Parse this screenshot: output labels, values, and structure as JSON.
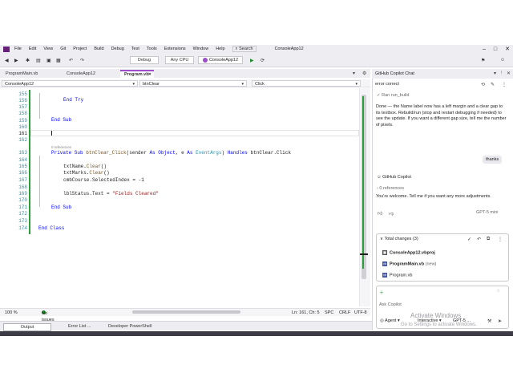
{
  "menu": {
    "items": [
      "File",
      "Edit",
      "View",
      "Git",
      "Project",
      "Build",
      "Debug",
      "Test",
      "Tools",
      "Extensions",
      "Window",
      "Help"
    ],
    "search": "Search",
    "solution_title": "ConsoleApp12"
  },
  "toolbar": {
    "config": "Debug",
    "platform": "Any CPU",
    "run_target": "ConsoleApp12"
  },
  "tabs": [
    {
      "label": "ProgramMain.vb",
      "active": false
    },
    {
      "label": "ConsoleApp12",
      "active": false
    },
    {
      "label": "Program.vb",
      "active": true
    }
  ],
  "nav": {
    "project": "ConsoleApp12",
    "member": "btnClear",
    "event": "Click"
  },
  "editor": {
    "lines": [
      {
        "n": "155",
        "text": ""
      },
      {
        "n": "156",
        "text": "End Try"
      },
      {
        "n": "157",
        "text": ""
      },
      {
        "n": "158",
        "text": "End Sub"
      },
      {
        "n": "159",
        "text": ""
      },
      {
        "n": "160",
        "text": ""
      },
      {
        "n": "161",
        "text": ""
      },
      {
        "n": "162",
        "text": ""
      },
      {
        "n": "163",
        "text": "Private Sub btnClear_Click(sender As Object, e As EventArgs) Handles btnClear.Click"
      },
      {
        "n": "164",
        "text": ""
      },
      {
        "n": "165",
        "text": "txtName.Clear()"
      },
      {
        "n": "166",
        "text": "txtMarks.Clear()"
      },
      {
        "n": "167",
        "text": "cmbCourse.SelectedIndex = -1"
      },
      {
        "n": "168",
        "text": ""
      },
      {
        "n": "169",
        "text": "lblStatus.Text = \"Fields Cleared\""
      },
      {
        "n": "170",
        "text": ""
      },
      {
        "n": "171",
        "text": "End Sub"
      },
      {
        "n": "172",
        "text": ""
      },
      {
        "n": "173",
        "text": ""
      },
      {
        "n": "174",
        "text": "End Class"
      }
    ],
    "refs_label": "0 references"
  },
  "status": {
    "zoom": "100 %",
    "issues": "No issues found",
    "position": "Ln: 161, Ch: 5",
    "spc": "SPC",
    "crlf": "CRLF",
    "encoding": "UTF-8"
  },
  "tool_tabs": [
    "Output",
    "Error List ...",
    "Developer PowerShell"
  ],
  "copilot": {
    "title": "GitHub Copilot Chat",
    "thread": "error correct",
    "ran": "Ran run_build",
    "reply1": "Done — the Name label now has a left margin and a clear gap to its textbox. Rebuild/run (stop and restart debugging if needed) to see the update. If you want a different gap size, tell me the number of pixels.",
    "user_msg": "thanks",
    "author": "GitHub Copilot",
    "refs": "0 references",
    "reply2": "You're welcome. Tell me if you want any more adjustments.",
    "model_tag": "GPT-5 mini",
    "changes_title": "Total changes (3)",
    "files": [
      {
        "name": "ConsoleApp12.vbproj",
        "tag": ""
      },
      {
        "name": "ProgramMain.vb",
        "tag": "(new)"
      },
      {
        "name": "Program.vb",
        "tag": ""
      }
    ],
    "input_placeholder": "Ask Copilot",
    "agent": "Agent",
    "mode": "Interactive",
    "model": "GPT-5 ...",
    "watermark_title": "Activate Windows",
    "watermark_sub": "Go to Settings to activate Windows."
  }
}
